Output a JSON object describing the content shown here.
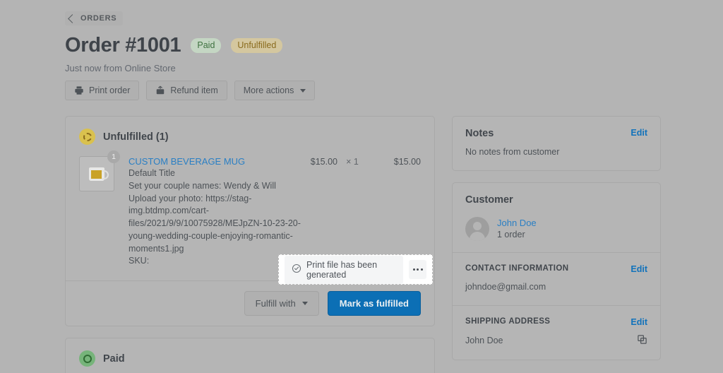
{
  "breadcrumb": {
    "label": "ORDERS",
    "icon": "chevron-left-icon"
  },
  "header": {
    "title": "Order #1001",
    "badges": [
      {
        "label": "Paid",
        "color": "#3f7240",
        "bg": "#c4d6c3"
      },
      {
        "label": "Unfulfilled",
        "color": "#8a6b1d",
        "bg": "#d4c79f"
      }
    ],
    "meta": "Just now from Online Store",
    "actions": [
      {
        "label": "Print order",
        "icon": "printer-icon"
      },
      {
        "label": "Refund item",
        "icon": "refund-icon"
      },
      {
        "label": "More actions",
        "icon": "chevron-down-icon"
      }
    ]
  },
  "fulfillment": {
    "status_label": "Unfulfilled (1)",
    "status_icon": "dashed-circle-icon",
    "status_color": "#d9c14e",
    "item": {
      "thumbnail_icon": "mug-thumbnail",
      "quantity_badge": "1",
      "title": "CUSTOM BEVERAGE MUG",
      "variant": "Default Title",
      "property_names": "Set your couple names: Wendy & Will",
      "property_photo": "Upload your photo: https://stag-img.btdmp.com/cart-files/2021/9/9/10075928/MEJpZN-10-23-20-young-wedding-couple-enjoying-romantic-moments1.jpg",
      "sku": "SKU:",
      "unit_price": "$15.00",
      "quantity": "× 1",
      "total_price": "$15.00"
    },
    "footer": {
      "fulfill_with_label": "Fulfill with",
      "mark_fulfilled_label": "Mark as fulfilled"
    }
  },
  "highlight": {
    "chip_label": "Print file has been generated",
    "chip_icon": "check-circle-icon",
    "more_icon": "ellipsis-icon"
  },
  "paid_card": {
    "status_label": "Paid",
    "status_icon": "check-circle-icon",
    "status_color": "#76b47a"
  },
  "sidebar": {
    "notes": {
      "title": "Notes",
      "edit_label": "Edit",
      "body": "No notes from customer"
    },
    "customer": {
      "title": "Customer",
      "avatar_icon": "person-avatar-icon",
      "name": "John Doe",
      "orders": "1 order",
      "contact": {
        "title": "CONTACT INFORMATION",
        "edit_label": "Edit",
        "email": "johndoe@gmail.com"
      },
      "shipping": {
        "title": "SHIPPING ADDRESS",
        "edit_label": "Edit",
        "name": "John Doe",
        "copy_icon": "copy-icon"
      }
    }
  }
}
